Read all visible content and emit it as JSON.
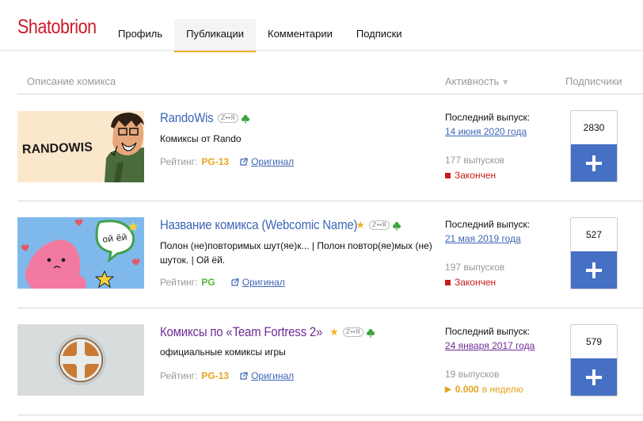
{
  "header": {
    "logo": "Shatobrion",
    "tabs": [
      {
        "label": "Профиль",
        "active": false
      },
      {
        "label": "Публикации",
        "active": true
      },
      {
        "label": "Комментарии",
        "active": false
      },
      {
        "label": "Подписки",
        "active": false
      }
    ]
  },
  "columns": {
    "description": "Описание комикса",
    "activity": "Активность",
    "subscribers": "Подписчики"
  },
  "labels": {
    "rating": "Рейтинг:",
    "original": "Оригинал",
    "last_release": "Последний выпуск:",
    "zpill": "Z↔Я"
  },
  "colors": {
    "accent_red": "#cc1a2a",
    "tab_underline": "#f1b32c",
    "link_blue": "#3d66b6",
    "visited_purple": "#6f2d95",
    "subscribe_blue": "#4570c4",
    "finished_red": "#c71b1b",
    "rating_pg13": "#e8a31e",
    "rating_pg": "#58b13c"
  },
  "comics": [
    {
      "title": "RandoWis",
      "thumb_text": "RANDOWIS",
      "starred": false,
      "description": "Комиксы от Rando",
      "rating": "PG-13",
      "last_date": "14 июня 2020 года",
      "issues": "177 выпусков",
      "status": "Закончен",
      "subscribers": "2830"
    },
    {
      "title": "Название комикса (Webcomic Name)",
      "thumb_text": "ой ёй",
      "starred": true,
      "description": "Полон (не)повторимых шут(яе)к... | Полон повтор(яе)мых (не) шуток. | Ой ёй.",
      "rating": "PG",
      "last_date": "21 мая 2019 года",
      "issues": "197 выпусков",
      "status": "Закончен",
      "subscribers": "527"
    },
    {
      "title": "Комиксы по «Team Fortress 2»",
      "starred": true,
      "description": "официальные комиксы игры",
      "rating": "PG-13",
      "last_date": "24 января 2017 года",
      "issues": "19 выпусков",
      "status": "0.000",
      "status_unit": "в неделю",
      "subscribers": "579"
    }
  ]
}
